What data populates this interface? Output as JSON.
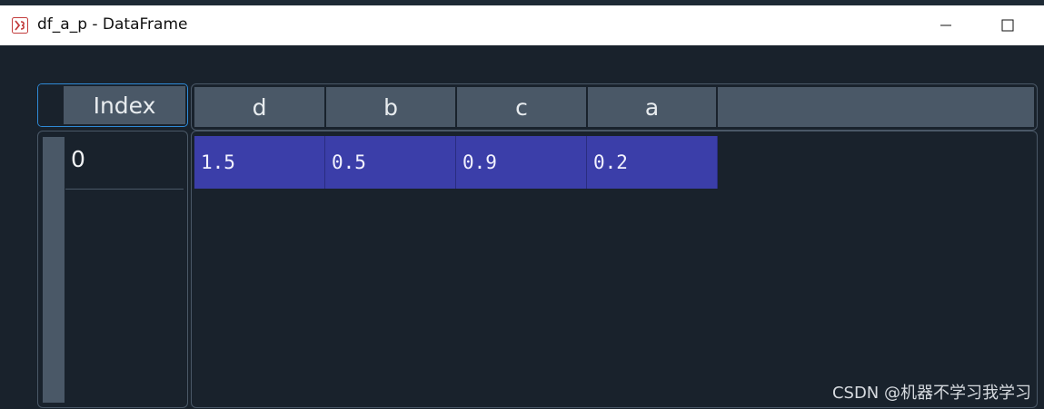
{
  "window": {
    "title": "df_a_p - DataFrame",
    "icon": "spyder-variable-explorer-icon",
    "minimize_label": "—",
    "maximize_label": "☐"
  },
  "table": {
    "index_header": "Index",
    "columns": [
      "d",
      "b",
      "c",
      "a"
    ],
    "rows": [
      {
        "index": "0",
        "values": [
          "1.5",
          "0.5",
          "0.9",
          "0.2"
        ]
      }
    ],
    "selected_cell_color": "#3b3ea9",
    "header_color": "#4a5867",
    "background_color": "#19222c"
  },
  "watermark": "CSDN @机器不学习我学习"
}
